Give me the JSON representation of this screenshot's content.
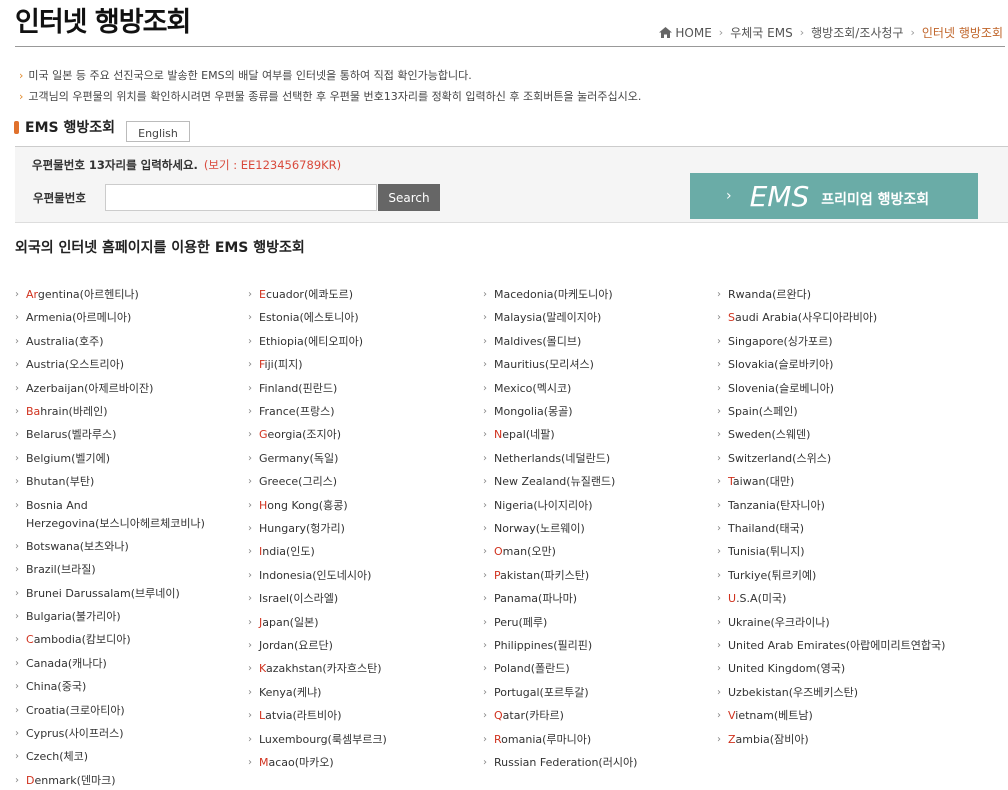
{
  "header": {
    "title": "인터넷 행방조회",
    "breadcrumb": [
      "HOME",
      "우체국 EMS",
      "행방조회/조사청구",
      "인터넷 행방조회"
    ]
  },
  "notices": [
    "미국 일본 등 주요 선진국으로 발송한 EMS의 배달 여부를 인터넷을 통하여 직접 확인가능합니다.",
    "고객님의 우편물의 위치를 확인하시려면 우편물 종류를 선택한 후 우편물 번호13자리를 정확히 입력하신 후 조회버튼을 눌러주십시오."
  ],
  "section": {
    "title": "EMS 행방조회",
    "lang_button": "English"
  },
  "search": {
    "hint": "우편물번호 13자리를 입력하세요.",
    "example": "(보기 : EE123456789KR)",
    "label": "우편물번호",
    "value": "",
    "button": "Search"
  },
  "premium": {
    "ems": "EMS",
    "label": "프리미엄 행방조회"
  },
  "foreign": {
    "title": "외국의 인터넷 홈페이지를 이용한 EMS 행방조회",
    "highlight_color": "#d0321e",
    "columns": [
      [
        {
          "hl": "",
          "rest": "Argentina(아르헨티나)",
          "red": "Ar"
        },
        {
          "hl": "",
          "rest": "Armenia(아르메니아)"
        },
        {
          "hl": "",
          "rest": "Australia(호주)"
        },
        {
          "hl": "",
          "rest": "Austria(오스트리아)"
        },
        {
          "hl": "",
          "rest": "Azerbaijan(아제르바이잔)"
        },
        {
          "hl": "Ba",
          "rest": "hrain(바레인)"
        },
        {
          "hl": "",
          "rest": "Belarus(벨라루스)"
        },
        {
          "hl": "",
          "rest": "Belgium(벨기에)"
        },
        {
          "hl": "",
          "rest": "Bhutan(부탄)"
        },
        {
          "hl": "",
          "rest": "Bosnia And"
        },
        {
          "hl": "",
          "rest": "Herzegovina(보스니아헤르체코비나)"
        },
        {
          "hl": "",
          "rest": "Botswana(보츠와나)"
        },
        {
          "hl": "",
          "rest": "Brazil(브라질)"
        },
        {
          "hl": "",
          "rest": "Brunei Darussalam(브루네이)"
        },
        {
          "hl": "",
          "rest": "Bulgaria(불가리아)"
        },
        {
          "hl": "C",
          "rest": "ambodia(캄보디아)"
        },
        {
          "hl": "",
          "rest": "Canada(캐나다)"
        },
        {
          "hl": "",
          "rest": "China(중국)"
        },
        {
          "hl": "",
          "rest": "Croatia(크로아티아)"
        },
        {
          "hl": "",
          "rest": "Cyprus(사이프러스)"
        },
        {
          "hl": "",
          "rest": "Czech(체코)"
        },
        {
          "hl": "D",
          "rest": "enmark(덴마크)"
        }
      ],
      [
        {
          "hl": "E",
          "rest": "cuador(에콰도르)"
        },
        {
          "hl": "",
          "rest": "Estonia(에스토니아)"
        },
        {
          "hl": "",
          "rest": "Ethiopia(에티오피아)"
        },
        {
          "hl": "F",
          "rest": "iji(피지)"
        },
        {
          "hl": "",
          "rest": "Finland(핀란드)"
        },
        {
          "hl": "",
          "rest": "France(프랑스)"
        },
        {
          "hl": "G",
          "rest": "eorgia(조지아)"
        },
        {
          "hl": "",
          "rest": "Germany(독일)"
        },
        {
          "hl": "",
          "rest": "Greece(그리스)"
        },
        {
          "hl": "H",
          "rest": "ong Kong(홍콩)"
        },
        {
          "hl": "",
          "rest": "Hungary(헝가리)"
        },
        {
          "hl": "I",
          "rest": "ndia(인도)"
        },
        {
          "hl": "",
          "rest": "Indonesia(인도네시아)"
        },
        {
          "hl": "",
          "rest": "Israel(이스라엘)"
        },
        {
          "hl": "J",
          "rest": "apan(일본)"
        },
        {
          "hl": "",
          "rest": "Jordan(요르단)"
        },
        {
          "hl": "K",
          "rest": "azakhstan(카자흐스탄)"
        },
        {
          "hl": "",
          "rest": "Kenya(케냐)"
        },
        {
          "hl": "L",
          "rest": "atvia(라트비아)"
        },
        {
          "hl": "",
          "rest": "Luxembourg(룩셈부르크)"
        },
        {
          "hl": "M",
          "rest": "acao(마카오)"
        }
      ],
      [
        {
          "hl": "",
          "rest": "Macedonia(마케도니아)"
        },
        {
          "hl": "",
          "rest": "Malaysia(말레이지아)"
        },
        {
          "hl": "",
          "rest": "Maldives(몰디브)"
        },
        {
          "hl": "",
          "rest": "Mauritius(모리셔스)"
        },
        {
          "hl": "",
          "rest": "Mexico(멕시코)"
        },
        {
          "hl": "",
          "rest": "Mongolia(몽골)"
        },
        {
          "hl": "N",
          "rest": "epal(네팔)"
        },
        {
          "hl": "",
          "rest": "Netherlands(네덜란드)"
        },
        {
          "hl": "",
          "rest": "New Zealand(뉴질랜드)"
        },
        {
          "hl": "",
          "rest": "Nigeria(나이지리아)"
        },
        {
          "hl": "",
          "rest": "Norway(노르웨이)"
        },
        {
          "hl": "O",
          "rest": "man(오만)"
        },
        {
          "hl": "P",
          "rest": "akistan(파키스탄)"
        },
        {
          "hl": "",
          "rest": "Panama(파나마)"
        },
        {
          "hl": "",
          "rest": "Peru(페루)"
        },
        {
          "hl": "",
          "rest": "Philippines(필리핀)"
        },
        {
          "hl": "",
          "rest": "Poland(폴란드)"
        },
        {
          "hl": "",
          "rest": "Portugal(포르투갈)"
        },
        {
          "hl": "Q",
          "rest": "atar(카타르)"
        },
        {
          "hl": "R",
          "rest": "omania(루마니아)"
        },
        {
          "hl": "",
          "rest": "Russian Federation(러시아)"
        }
      ],
      [
        {
          "hl": "",
          "rest": "Rwanda(르완다)"
        },
        {
          "hl": "S",
          "rest": "audi Arabia(사우디아라비아)"
        },
        {
          "hl": "",
          "rest": "Singapore(싱가포르)"
        },
        {
          "hl": "",
          "rest": "Slovakia(슬로바키아)"
        },
        {
          "hl": "",
          "rest": "Slovenia(슬로베니아)"
        },
        {
          "hl": "",
          "rest": "Spain(스페인)"
        },
        {
          "hl": "",
          "rest": "Sweden(스웨덴)"
        },
        {
          "hl": "",
          "rest": "Switzerland(스위스)"
        },
        {
          "hl": "T",
          "rest": "aiwan(대만)"
        },
        {
          "hl": "",
          "rest": "Tanzania(탄자니아)"
        },
        {
          "hl": "",
          "rest": "Thailand(태국)"
        },
        {
          "hl": "",
          "rest": "Tunisia(튀니지)"
        },
        {
          "hl": "",
          "rest": "Turkiye(튀르키예)"
        },
        {
          "hl": "U",
          "rest": ".S.A(미국)"
        },
        {
          "hl": "",
          "rest": "Ukraine(우크라이나)"
        },
        {
          "hl": "",
          "rest": "United Arab Emirates(아랍에미리트연합국)"
        },
        {
          "hl": "",
          "rest": "United Kingdom(영국)"
        },
        {
          "hl": "",
          "rest": "Uzbekistan(우즈베키스탄)"
        },
        {
          "hl": "V",
          "rest": "ietnam(베트남)"
        },
        {
          "hl": "Z",
          "rest": "ambia(잠비아)"
        }
      ]
    ]
  }
}
